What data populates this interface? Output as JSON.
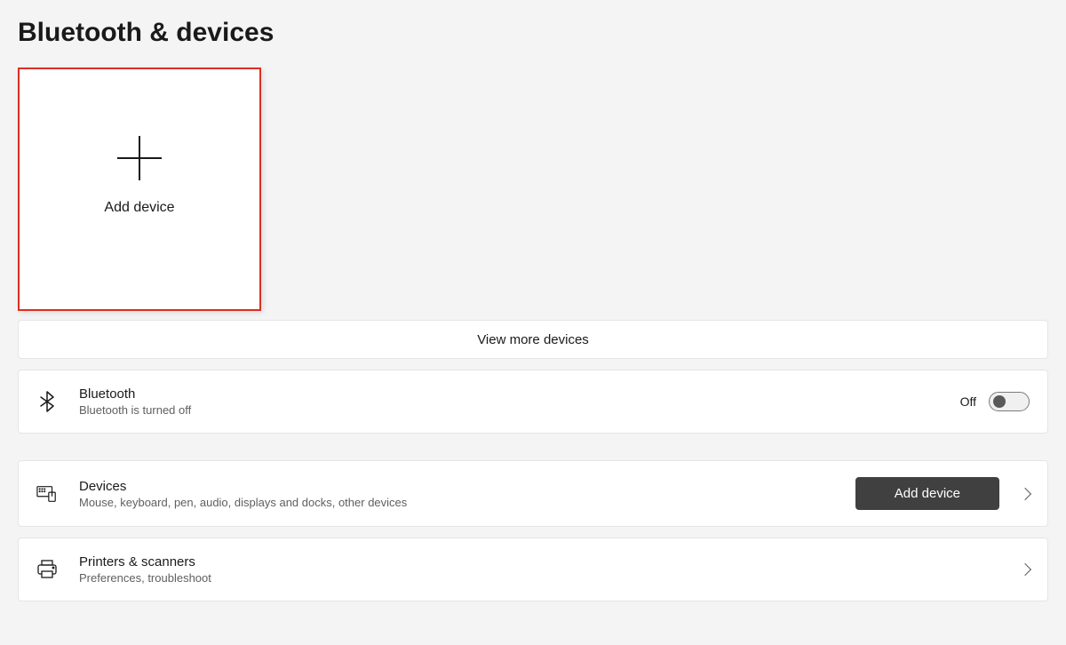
{
  "header": {
    "title": "Bluetooth & devices"
  },
  "tiles": {
    "add_device_label": "Add device"
  },
  "buttons": {
    "view_more": "View more devices",
    "add_device_action": "Add device"
  },
  "rows": {
    "bluetooth": {
      "title": "Bluetooth",
      "subtitle": "Bluetooth is turned off",
      "toggle_state_label": "Off"
    },
    "devices": {
      "title": "Devices",
      "subtitle": "Mouse, keyboard, pen, audio, displays and docks, other devices"
    },
    "printers": {
      "title": "Printers & scanners",
      "subtitle": "Preferences, troubleshoot"
    }
  }
}
